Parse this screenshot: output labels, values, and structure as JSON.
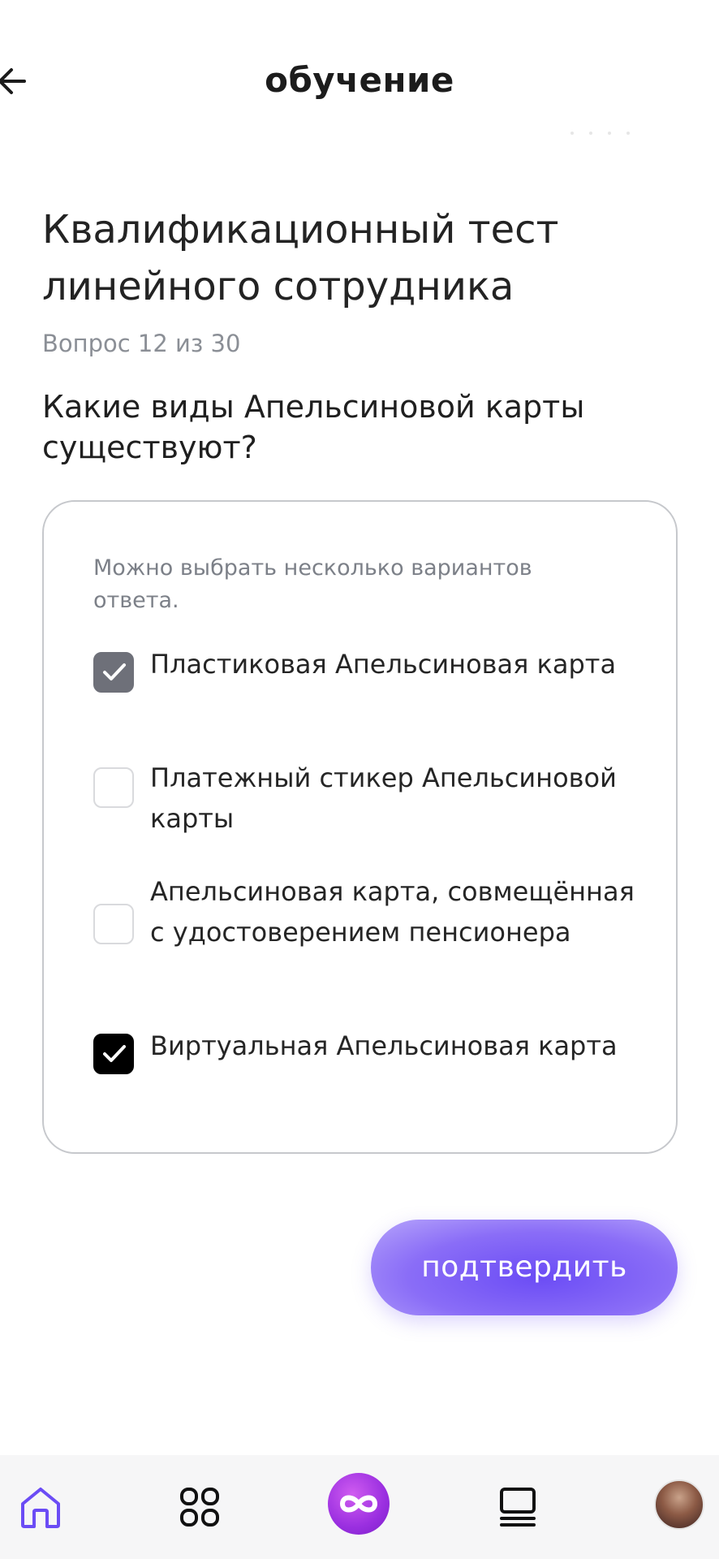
{
  "header": {
    "title": "обучение"
  },
  "test": {
    "title": "Квалификационный тест линейного сотрудника",
    "counter": "Вопрос 12 из 30",
    "question": "Какие виды Апельсиновой карты существуют?"
  },
  "options_card": {
    "hint": "Можно выбрать несколько вариантов ответа.",
    "options": [
      {
        "label": "Пластиковая Апельсиновая карта",
        "checked": true
      },
      {
        "label": "Платежный стикер Апельсиновой карты",
        "checked": false
      },
      {
        "label": "Апельсиновая карта, совмещённая с удостоверением пенсионера",
        "checked": false
      },
      {
        "label": "Виртуальная Апельсиновая карта",
        "checked": true
      }
    ]
  },
  "confirm_button": {
    "label": "подтвердить"
  },
  "bottom_nav": {
    "items": [
      "home-icon",
      "apps-grid-icon",
      "infinity-logo-icon",
      "catalog-icon",
      "profile-avatar"
    ]
  },
  "colors": {
    "accent": "#6b4cf5",
    "checkbox_checked_gray": "#6e7079",
    "checkbox_checked_black": "#000000",
    "nav_home_icon": "#6b4cf5"
  }
}
